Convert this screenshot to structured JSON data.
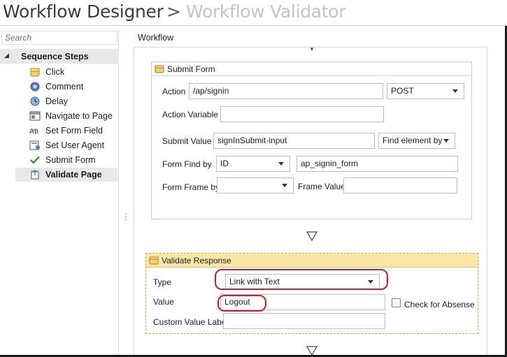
{
  "header": {
    "title": "Workflow Designer",
    "separator": ">",
    "current": "Workflow Validator"
  },
  "sidebar": {
    "search_placeholder": "Search",
    "group_label": "Sequence Steps",
    "items": [
      {
        "label": "Click",
        "icon": "hand-click-icon"
      },
      {
        "label": "Comment",
        "icon": "gear-comment-icon"
      },
      {
        "label": "Delay",
        "icon": "clock-icon"
      },
      {
        "label": "Navigate to Page",
        "icon": "web-page-icon"
      },
      {
        "label": "Set Form Field",
        "icon": "form-field-icon"
      },
      {
        "label": "Set User Agent",
        "icon": "user-agent-icon"
      },
      {
        "label": "Submit Form",
        "icon": "checkmark-icon"
      },
      {
        "label": "Validate Page",
        "icon": "validate-page-icon",
        "selected": true
      }
    ]
  },
  "canvas": {
    "tab_label": "Workflow"
  },
  "submit_form": {
    "title": "Submit Form",
    "action_label": "Action",
    "action_value": "/ap/signin",
    "method_value": "POST",
    "action_variable_label": "Action Variable",
    "action_variable_value": "",
    "submit_value_label": "Submit Value",
    "submit_value_value": "signInSubmit-input",
    "find_element_value": "Find element by",
    "form_find_by_label": "Form Find by",
    "form_find_by_value": "ID",
    "form_find_value": "ap_signin_form",
    "form_frame_by_label": "Form Frame by",
    "form_frame_by_value": "",
    "frame_value_label": "Frame Value",
    "frame_value_value": ""
  },
  "validate_response": {
    "title": "Validate Response",
    "type_label": "Type",
    "type_value": "Link with Text",
    "value_label": "Value",
    "value_value": "Logout",
    "check_absense_label": "Check for Absense",
    "check_absense_checked": false,
    "custom_value_label": "Custom Value Label",
    "custom_value_value": ""
  },
  "colors": {
    "highlight_ring": "#d81b28",
    "activity_header_yellow": "#fbe7a5",
    "selected_bg": "#e8e8e8"
  }
}
